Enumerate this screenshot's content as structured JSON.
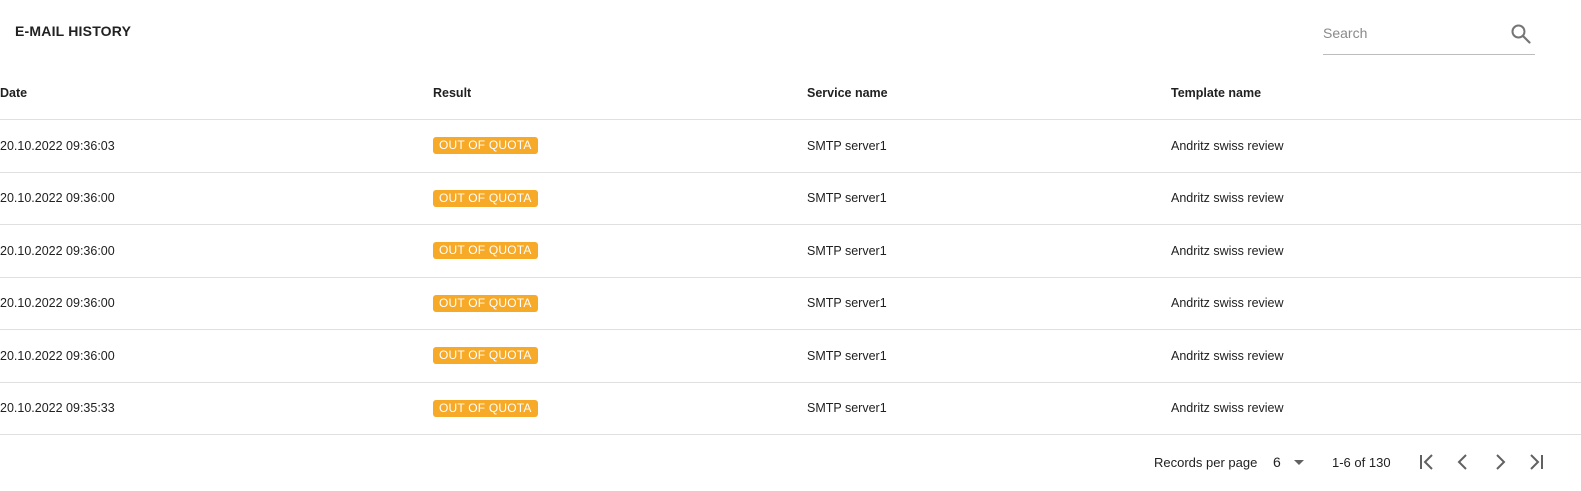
{
  "header": {
    "title": "E-MAIL HISTORY",
    "search_placeholder": "Search",
    "search_value": ""
  },
  "table": {
    "columns": [
      "Date",
      "Result",
      "Service name",
      "Template name"
    ],
    "rows": [
      {
        "date": "20.10.2022 09:36:03",
        "result": "OUT OF QUOTA",
        "service": "SMTP server1",
        "template": "Andritz swiss review"
      },
      {
        "date": "20.10.2022 09:36:00",
        "result": "OUT OF QUOTA",
        "service": "SMTP server1",
        "template": "Andritz swiss review"
      },
      {
        "date": "20.10.2022 09:36:00",
        "result": "OUT OF QUOTA",
        "service": "SMTP server1",
        "template": "Andritz swiss review"
      },
      {
        "date": "20.10.2022 09:36:00",
        "result": "OUT OF QUOTA",
        "service": "SMTP server1",
        "template": "Andritz swiss review"
      },
      {
        "date": "20.10.2022 09:36:00",
        "result": "OUT OF QUOTA",
        "service": "SMTP server1",
        "template": "Andritz swiss review"
      },
      {
        "date": "20.10.2022 09:35:33",
        "result": "OUT OF QUOTA",
        "service": "SMTP server1",
        "template": "Andritz swiss review"
      }
    ]
  },
  "footer": {
    "records_per_page_label": "Records per page",
    "records_per_page_value": "6",
    "range_text": "1-6 of 130"
  },
  "icons": {
    "search": "search-icon",
    "dropdown": "caret-down-icon",
    "first": "first-page-icon",
    "prev": "chevron-left-icon",
    "next": "chevron-right-icon",
    "last": "last-page-icon"
  },
  "colors": {
    "badge_out_of_quota": "#f7a928",
    "divider": "#e0e0e0",
    "text": "#212121"
  }
}
